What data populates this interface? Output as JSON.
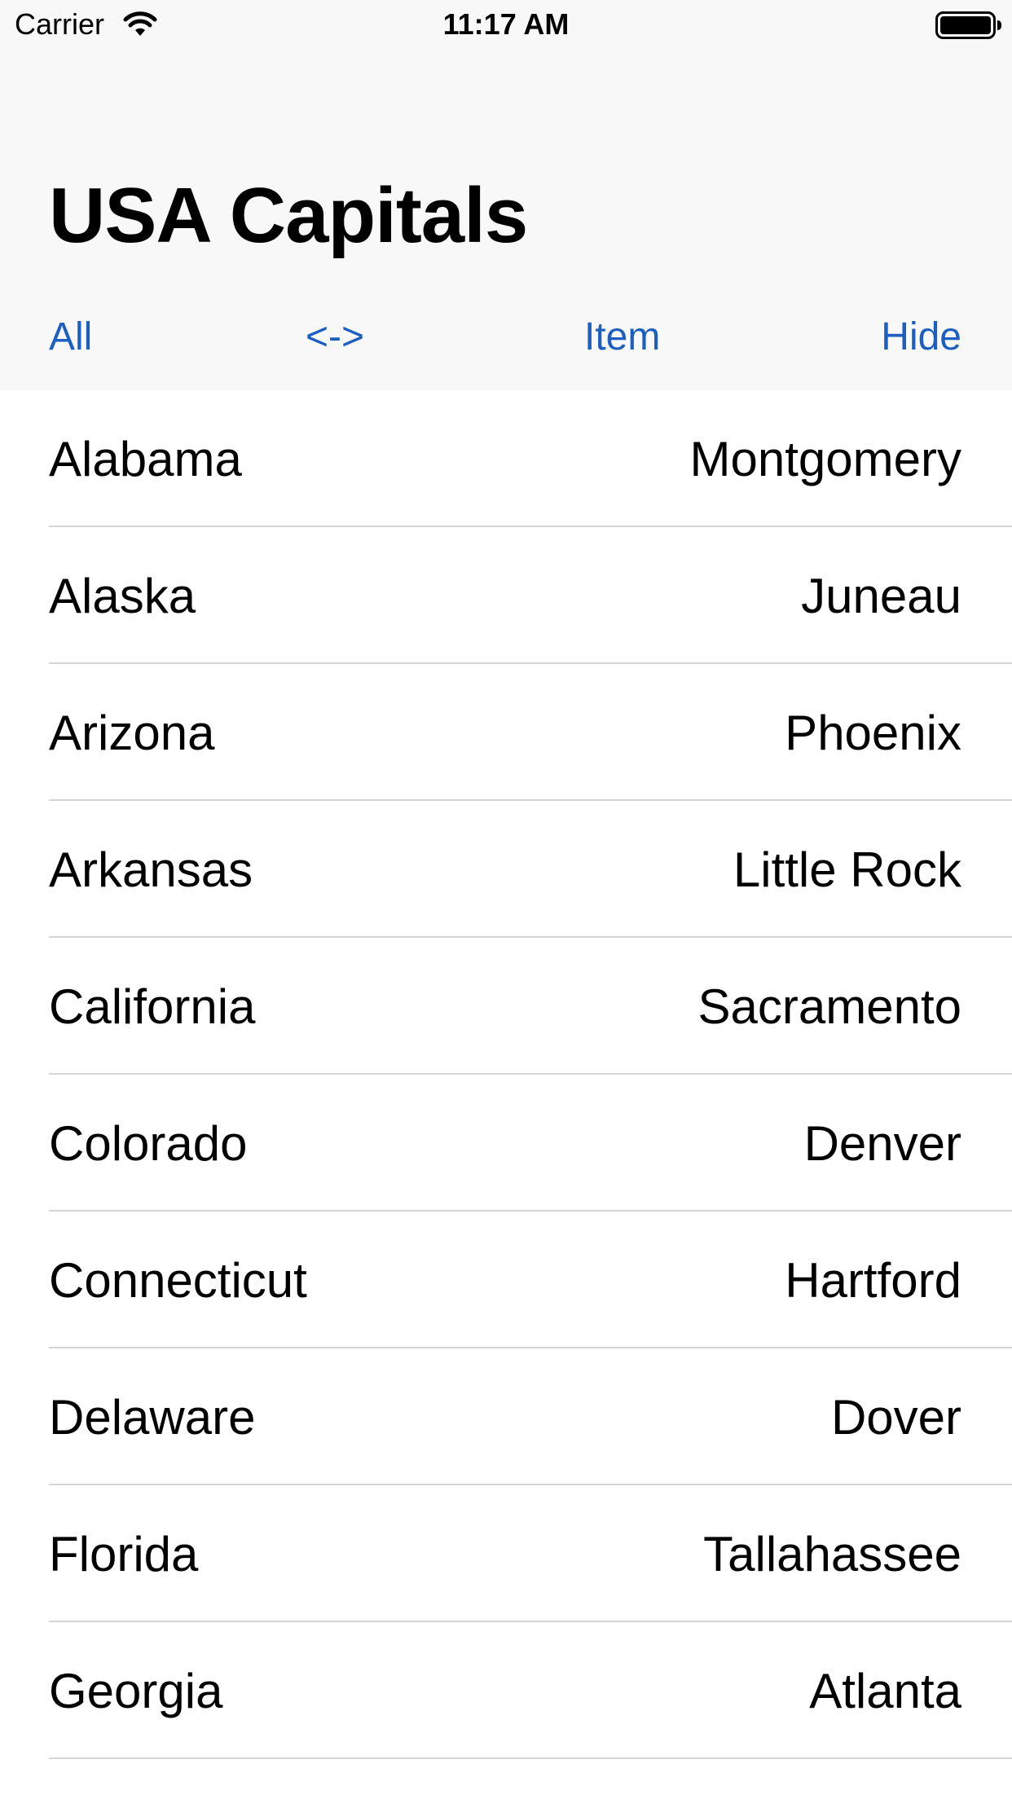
{
  "status_bar": {
    "carrier": "Carrier",
    "time": "11:17 AM"
  },
  "nav": {
    "title": "USA Capitals"
  },
  "toolbar": {
    "all_label": "All",
    "swap_label": "<->",
    "item_label": "Item",
    "hide_label": "Hide"
  },
  "colors": {
    "accent": "#1d5fc0",
    "bar_background": "#f8f8f8",
    "separator": "#d6d6d8"
  },
  "list": {
    "items": [
      {
        "state": "Alabama",
        "capital": "Montgomery"
      },
      {
        "state": "Alaska",
        "capital": "Juneau"
      },
      {
        "state": "Arizona",
        "capital": "Phoenix"
      },
      {
        "state": "Arkansas",
        "capital": "Little Rock"
      },
      {
        "state": "California",
        "capital": "Sacramento"
      },
      {
        "state": "Colorado",
        "capital": "Denver"
      },
      {
        "state": "Connecticut",
        "capital": "Hartford"
      },
      {
        "state": "Delaware",
        "capital": "Dover"
      },
      {
        "state": "Florida",
        "capital": "Tallahassee"
      },
      {
        "state": "Georgia",
        "capital": "Atlanta"
      }
    ]
  }
}
